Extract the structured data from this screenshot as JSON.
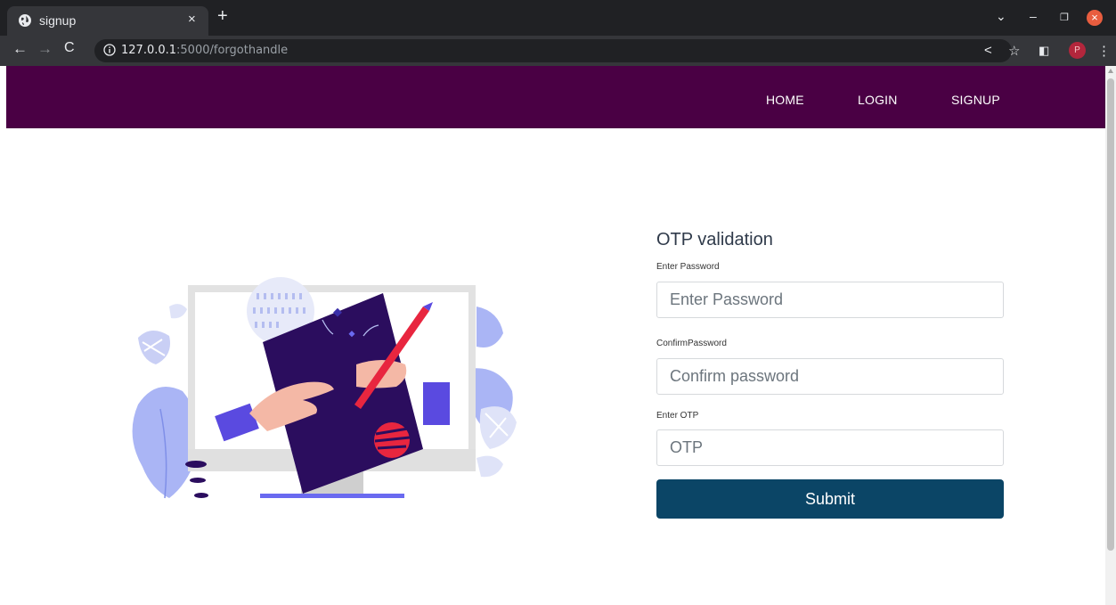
{
  "browser": {
    "tab_title": "signup",
    "tab_close": "×",
    "new_tab": "+",
    "url_host": "127.0.0.1",
    "url_rest": ":5000/forgothandle",
    "avatar_letter": "P",
    "window_close": "×"
  },
  "nav": {
    "home": "HOME",
    "login": "LOGIN",
    "signup": "SIGNUP"
  },
  "form": {
    "title": "OTP validation",
    "password_label": "Enter Password",
    "password_placeholder": "Enter Password",
    "confirm_label": "ConfirmPassword",
    "confirm_placeholder": "Confirm password",
    "otp_label": "Enter OTP",
    "otp_placeholder": "OTP",
    "submit_label": "Submit"
  },
  "colors": {
    "navbar": "#4a0044",
    "submit": "#0b4566"
  }
}
